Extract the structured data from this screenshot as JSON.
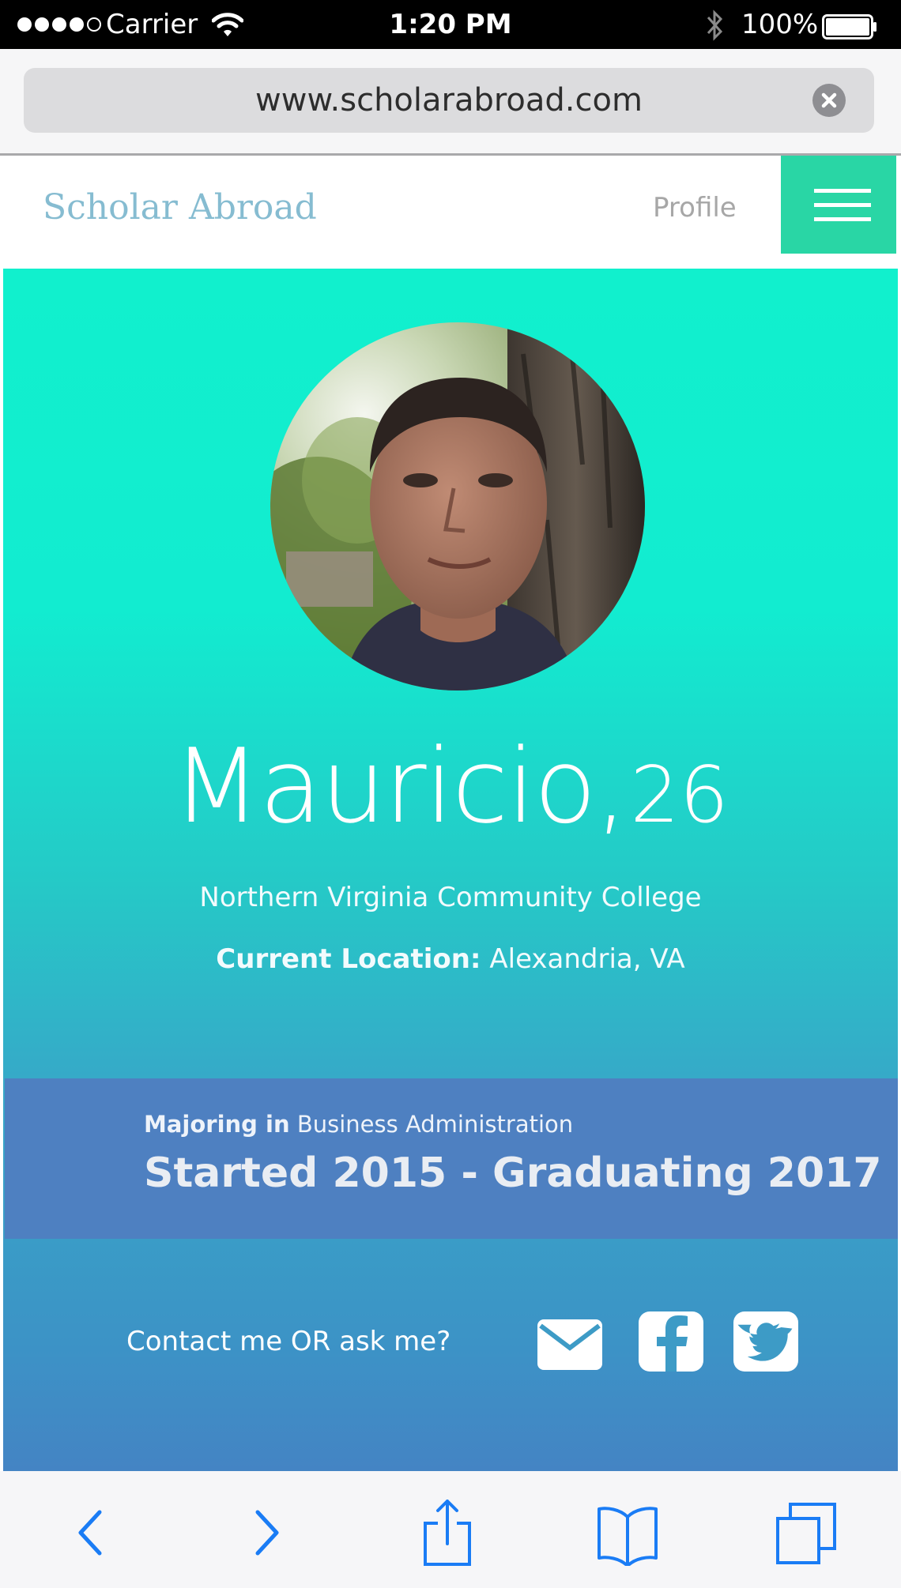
{
  "status_bar": {
    "carrier": "Carrier",
    "time": "1:20 PM",
    "battery": "100%"
  },
  "browser": {
    "url": "www.scholarabroad.com"
  },
  "site": {
    "logo": "Scholar Abroad",
    "nav_profile": "Profile"
  },
  "profile": {
    "name": "Mauricio,",
    "age": "26",
    "college": "Northern Virginia Community College",
    "location_label": "Current Location:",
    "location_value": "Alexandria, VA",
    "major_label": "Majoring in",
    "major_value": "Business Administration",
    "years": "Started 2015 - Graduating 2017",
    "contact_prompt": "Contact me OR ask me?"
  },
  "icons": {
    "signal": "signal-dots-icon",
    "wifi": "wifi-icon",
    "bluetooth": "bluetooth-icon",
    "battery": "battery-icon",
    "clear": "clear-url-icon",
    "menu": "hamburger-menu-icon",
    "mail": "mail-icon",
    "facebook": "facebook-icon",
    "twitter": "twitter-icon",
    "back": "back-icon",
    "forward": "forward-icon",
    "share": "share-icon",
    "bookmarks": "bookmarks-icon",
    "tabs": "tabs-icon"
  },
  "colors": {
    "hero_top": "#11f0cd",
    "hero_bottom": "#4484c4",
    "menu_button": "#29d6a5",
    "logo": "#86bcd1",
    "major_band": "#4e80c1",
    "toolbar_icons": "#1a7cf5"
  }
}
